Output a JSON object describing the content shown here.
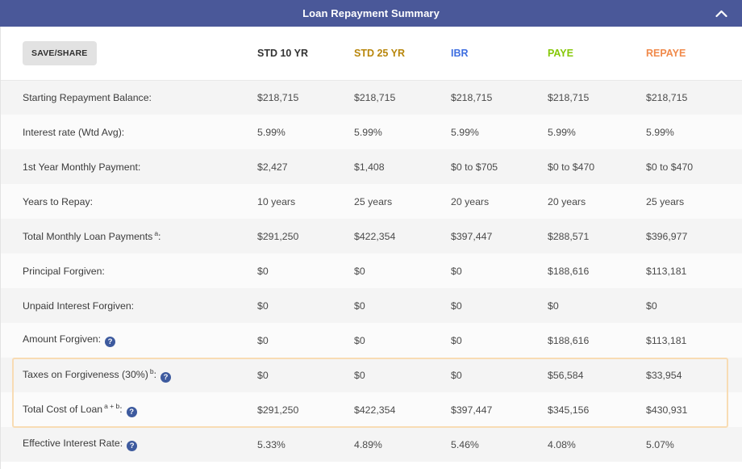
{
  "header": {
    "title": "Loan Repayment Summary",
    "collapse_icon": "chevron-up-icon",
    "bar_color": "#4a5899"
  },
  "toolbar": {
    "save_share_label": "SAVE/SHARE"
  },
  "table": {
    "columns": [
      {
        "label": "STD 10 YR",
        "color": "#333333"
      },
      {
        "label": "STD 25 YR",
        "color": "#b8860b"
      },
      {
        "label": "IBR",
        "color": "#3e6ee0"
      },
      {
        "label": "PAYE",
        "color": "#86c808"
      },
      {
        "label": "REPAYE",
        "color": "#f08a4b"
      }
    ],
    "rows": [
      {
        "label": "Starting Repayment Balance:",
        "marker": "",
        "help": false,
        "values": [
          "$218,715",
          "$218,715",
          "$218,715",
          "$218,715",
          "$218,715"
        ]
      },
      {
        "label": "Interest rate (Wtd Avg):",
        "marker": "",
        "help": false,
        "values": [
          "5.99%",
          "5.99%",
          "5.99%",
          "5.99%",
          "5.99%"
        ]
      },
      {
        "label": "1st Year Monthly Payment:",
        "marker": "",
        "help": false,
        "values": [
          "$2,427",
          "$1,408",
          "$0 to $705",
          "$0 to $470",
          "$0 to $470"
        ]
      },
      {
        "label": "Years to Repay:",
        "marker": "",
        "help": false,
        "values": [
          "10 years",
          "25 years",
          "20 years",
          "20 years",
          "25 years"
        ]
      },
      {
        "label": "Total Monthly Loan Payments",
        "marker": "a",
        "help": false,
        "colon_after_marker": true,
        "values": [
          "$291,250",
          "$422,354",
          "$397,447",
          "$288,571",
          "$396,977"
        ]
      },
      {
        "label": "Principal Forgiven:",
        "marker": "",
        "help": false,
        "values": [
          "$0",
          "$0",
          "$0",
          "$188,616",
          "$113,181"
        ]
      },
      {
        "label": "Unpaid Interest Forgiven:",
        "marker": "",
        "help": false,
        "values": [
          "$0",
          "$0",
          "$0",
          "$0",
          "$0"
        ]
      },
      {
        "label": "Amount Forgiven:",
        "marker": "",
        "help": true,
        "values": [
          "$0",
          "$0",
          "$0",
          "$188,616",
          "$113,181"
        ]
      },
      {
        "label": "Taxes on Forgiveness (30%)",
        "marker": "b",
        "help": true,
        "colon_after_marker": true,
        "values": [
          "$0",
          "$0",
          "$0",
          "$56,584",
          "$33,954"
        ]
      },
      {
        "label": "Total Cost of Loan",
        "marker": "a + b",
        "help": true,
        "colon_after_marker": true,
        "values": [
          "$291,250",
          "$422,354",
          "$397,447",
          "$345,156",
          "$430,931"
        ]
      },
      {
        "label": "Effective Interest Rate:",
        "marker": "",
        "help": true,
        "values": [
          "5.33%",
          "4.89%",
          "5.46%",
          "4.08%",
          "5.07%"
        ]
      }
    ],
    "highlight": {
      "from_row_label": "Amount Forgiven:",
      "to_row_label": "Taxes on Forgiveness (30%)",
      "border_color": "#f8dcb4"
    },
    "help_icon_glyph": "?",
    "help_icon_color": "#3d5a9e"
  }
}
